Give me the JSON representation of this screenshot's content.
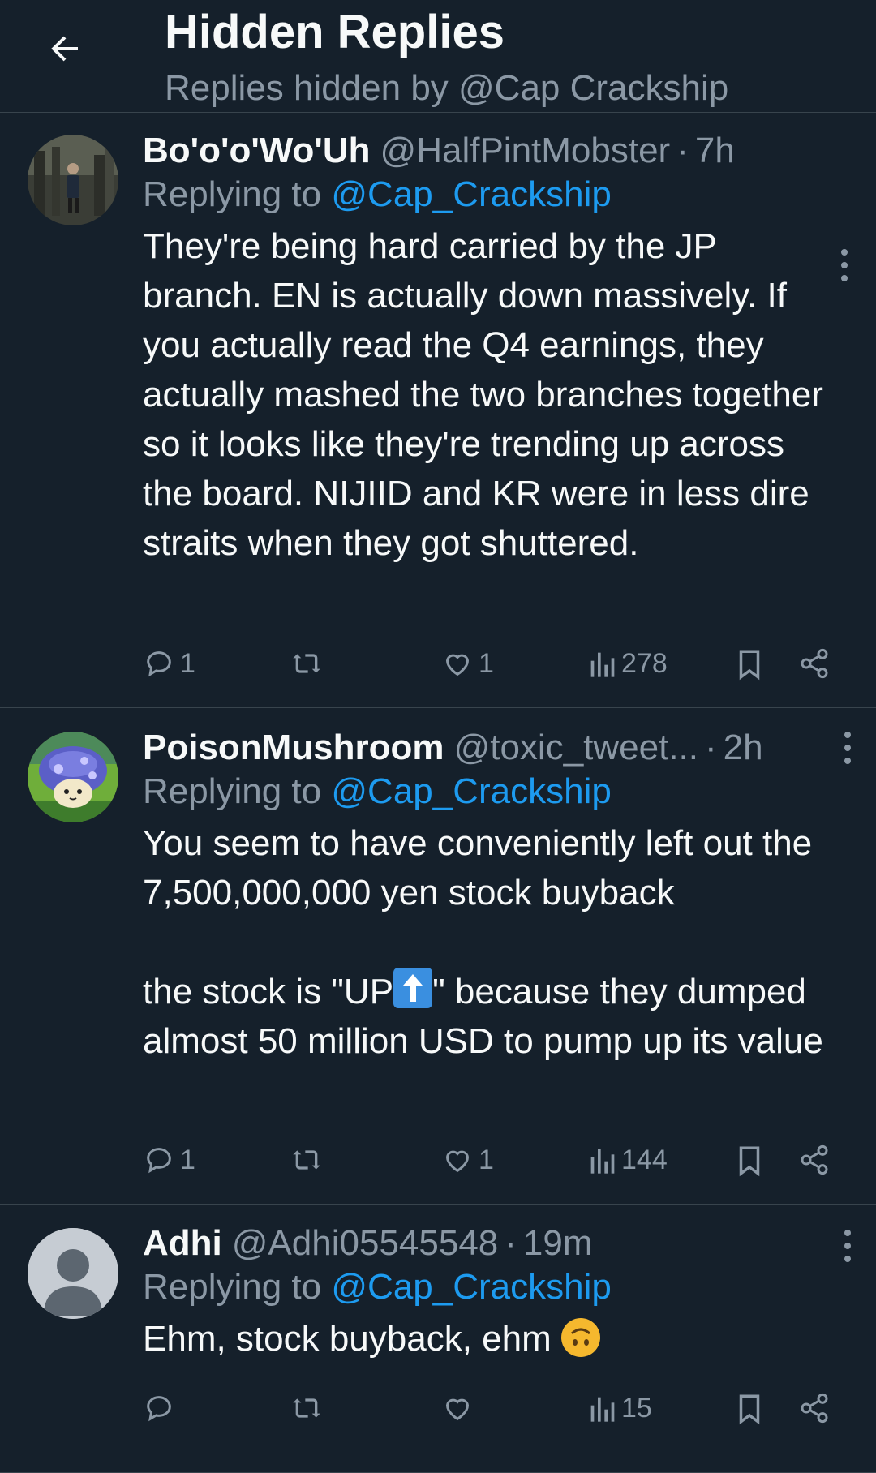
{
  "header": {
    "title": "Hidden Replies",
    "subtitle": "Replies hidden by @Cap Crackship"
  },
  "tweets": [
    {
      "display_name": "Bo'o'o'Wo'Uh",
      "handle": "@HalfPintMobster",
      "time": "7h",
      "replying_prefix": "Replying to",
      "replying_to": "@Cap_Crackship",
      "text": "They're being hard carried by the JP branch. EN is actually down massively. If you actually read the Q4 earnings, they actually mashed the two branches together so it looks like they're trending up across the board. NIJIID and KR were in less dire straits when they got shuttered.",
      "replies": "1",
      "retweets": "",
      "likes": "1",
      "views": "278"
    },
    {
      "display_name": "PoisonMushroom",
      "handle": "@toxic_tweet...",
      "time": "2h",
      "replying_prefix": "Replying to",
      "replying_to": "@Cap_Crackship",
      "text_a": "You seem to have conveniently left out the 7,500,000,000 yen stock buyback",
      "text_b1": "the stock is \"UP",
      "text_b2": "\" because they dumped almost 50 million USD to pump up its value",
      "replies": "1",
      "retweets": "",
      "likes": "1",
      "views": "144"
    },
    {
      "display_name": "Adhi",
      "handle": "@Adhi05545548",
      "time": "19m",
      "replying_prefix": "Replying to",
      "replying_to": "@Cap_Crackship",
      "text": "Ehm, stock buyback, ehm ",
      "replies": "",
      "retweets": "",
      "likes": "",
      "views": "15"
    }
  ],
  "icons": {
    "back": "arrow-left-icon",
    "more": "more-vertical-icon",
    "reply": "reply-bubble-icon",
    "retweet": "retweet-icon",
    "like": "heart-icon",
    "views": "bar-chart-icon",
    "bookmark": "bookmark-icon",
    "share": "share-icon",
    "up_arrow": "up-arrow-emoji",
    "face": "upside-down-face-emoji"
  },
  "colors": {
    "background": "#15202b",
    "text": "#f7f9f9",
    "muted": "#8b98a5",
    "link": "#1d9bf0",
    "divider": "#38444d"
  }
}
